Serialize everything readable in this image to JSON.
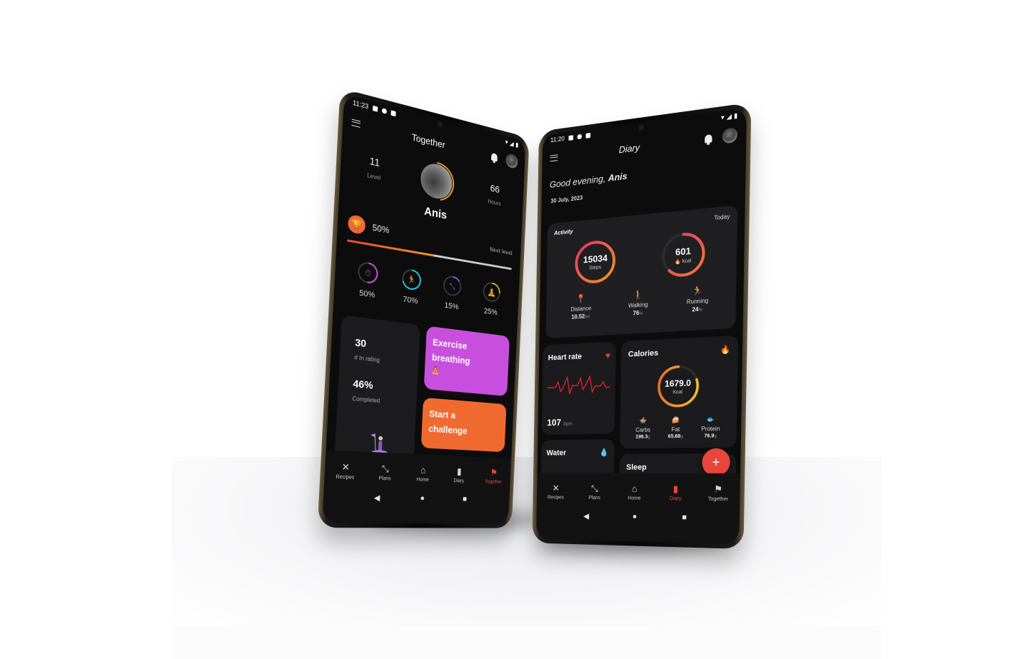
{
  "left_phone": {
    "status": {
      "time": "11:23"
    },
    "appbar": {
      "title": "Together"
    },
    "profile": {
      "level_value": "11",
      "level_label": "Level",
      "hours_value": "66",
      "hours_label": "Hours",
      "name": "Anis",
      "avatar_ring_progress": 0.45
    },
    "level_progress": {
      "percent_label": "50%",
      "next_label": "Next level",
      "fraction": 0.5
    },
    "rings": [
      {
        "icon": "stopwatch-icon",
        "glyph": "⏱",
        "percent": "50%",
        "fraction": 0.5,
        "color": "#c84fde"
      },
      {
        "icon": "running-icon",
        "glyph": "🏃",
        "percent": "70%",
        "fraction": 0.7,
        "color": "#25c6e0"
      },
      {
        "icon": "dumbbell-icon",
        "glyph": "⤡",
        "percent": "15%",
        "fraction": 0.15,
        "color": "#7b61e8"
      },
      {
        "icon": "meditation-icon",
        "glyph": "🧘",
        "percent": "25%",
        "fraction": 0.25,
        "color": "#f2a622"
      }
    ],
    "rating_card": {
      "rank_value": "30",
      "rank_label": "# In rating",
      "completed_value": "46%",
      "completed_label": "Completed"
    },
    "exercise_card": {
      "line1": "Exercise",
      "line2": "breathing",
      "icon": "meditation-icon"
    },
    "challenge_card": {
      "line1": "Start a",
      "line2": "challenge"
    },
    "nav": [
      {
        "label": "Recipes",
        "glyph": "✕",
        "icon": "fork-spoon-icon"
      },
      {
        "label": "Plans",
        "glyph": "⤡",
        "icon": "dumbbell-icon"
      },
      {
        "label": "Home",
        "glyph": "⌂",
        "icon": "home-icon"
      },
      {
        "label": "Diary",
        "glyph": "▮",
        "icon": "bar-chart-icon"
      },
      {
        "label": "Together",
        "glyph": "⚑",
        "icon": "flag-icon",
        "active": true
      }
    ],
    "sys_nav": {
      "back": "◀",
      "home": "●",
      "recents": "■"
    }
  },
  "right_phone": {
    "status": {
      "time": "11:20"
    },
    "appbar": {
      "title": "Diary"
    },
    "greeting": {
      "prefix": "Good evening, ",
      "name": "Anis"
    },
    "date": "30 July, 2023",
    "activity": {
      "title": "Activity",
      "period": "Today",
      "steps": {
        "value": "15034",
        "label": "Steps",
        "fraction": 1.0
      },
      "kcal": {
        "value": "601",
        "label": "kcal",
        "fraction": 0.62
      },
      "stats": [
        {
          "icon": "location-pin-icon",
          "glyph": "📍",
          "label": "Distance",
          "value": "10.52",
          "unit": "km",
          "color": "#f07a6a"
        },
        {
          "icon": "walking-icon",
          "glyph": "🚶",
          "label": "Walking",
          "value": "76",
          "unit": "%",
          "color": "#f29a3a"
        },
        {
          "icon": "running-icon",
          "glyph": "🏃",
          "label": "Running",
          "value": "24",
          "unit": "%",
          "color": "#ee4f7a"
        }
      ]
    },
    "heart_rate": {
      "title": "Heart rate",
      "value": "107",
      "unit": "bpm"
    },
    "water": {
      "title": "Water"
    },
    "calories": {
      "title": "Calories",
      "value": "1679.0",
      "unit": "Kcal",
      "fraction": 0.8,
      "macros": [
        {
          "icon": "bowl-icon",
          "label": "Carbs",
          "value": "196.3",
          "unit": "g",
          "color": "#f06a4a"
        },
        {
          "icon": "cake-icon",
          "label": "Fat",
          "value": "65.68",
          "unit": "g",
          "color": "#9aa0f0"
        },
        {
          "icon": "fish-icon",
          "label": "Protein",
          "value": "76.9",
          "unit": "g",
          "color": "#ee5a8a"
        }
      ]
    },
    "sleep": {
      "title": "Sleep"
    },
    "fab": "+",
    "nav": [
      {
        "label": "Recipes",
        "glyph": "✕",
        "icon": "fork-spoon-icon"
      },
      {
        "label": "Plans",
        "glyph": "⤡",
        "icon": "dumbbell-icon"
      },
      {
        "label": "Home",
        "glyph": "⌂",
        "icon": "home-icon"
      },
      {
        "label": "Diary",
        "glyph": "▮",
        "icon": "bar-chart-icon",
        "active": true
      },
      {
        "label": "Together",
        "glyph": "⚑",
        "icon": "flag-icon"
      }
    ],
    "sys_nav": {
      "back": "◀",
      "home": "●",
      "recents": "■"
    }
  }
}
